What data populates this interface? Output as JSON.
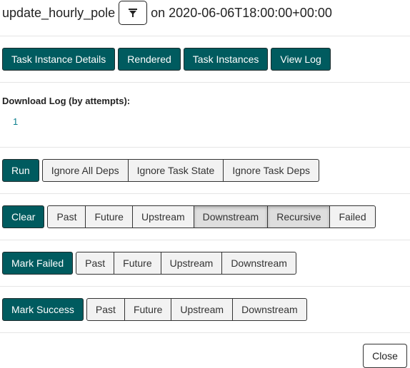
{
  "header": {
    "task_id": "update_hourly_pole",
    "on_text": "on 2020-06-06T18:00:00+00:00",
    "filter_icon": "filter-icon"
  },
  "nav_buttons": [
    "Task Instance Details",
    "Rendered",
    "Task Instances",
    "View Log"
  ],
  "download": {
    "label": "Download Log (by attempts):",
    "attempts": [
      "1"
    ]
  },
  "run": {
    "label": "Run",
    "options": [
      "Ignore All Deps",
      "Ignore Task State",
      "Ignore Task Deps"
    ]
  },
  "clear": {
    "label": "Clear",
    "options": [
      "Past",
      "Future",
      "Upstream",
      "Downstream",
      "Recursive",
      "Failed"
    ],
    "active": [
      "Downstream",
      "Recursive"
    ]
  },
  "mark_failed": {
    "label": "Mark Failed",
    "options": [
      "Past",
      "Future",
      "Upstream",
      "Downstream"
    ]
  },
  "mark_success": {
    "label": "Mark Success",
    "options": [
      "Past",
      "Future",
      "Upstream",
      "Downstream"
    ]
  },
  "close_label": "Close",
  "colors": {
    "primary": "#005b5f",
    "link": "#0a7e8c",
    "toggle_bg": "#f2f2f2"
  }
}
